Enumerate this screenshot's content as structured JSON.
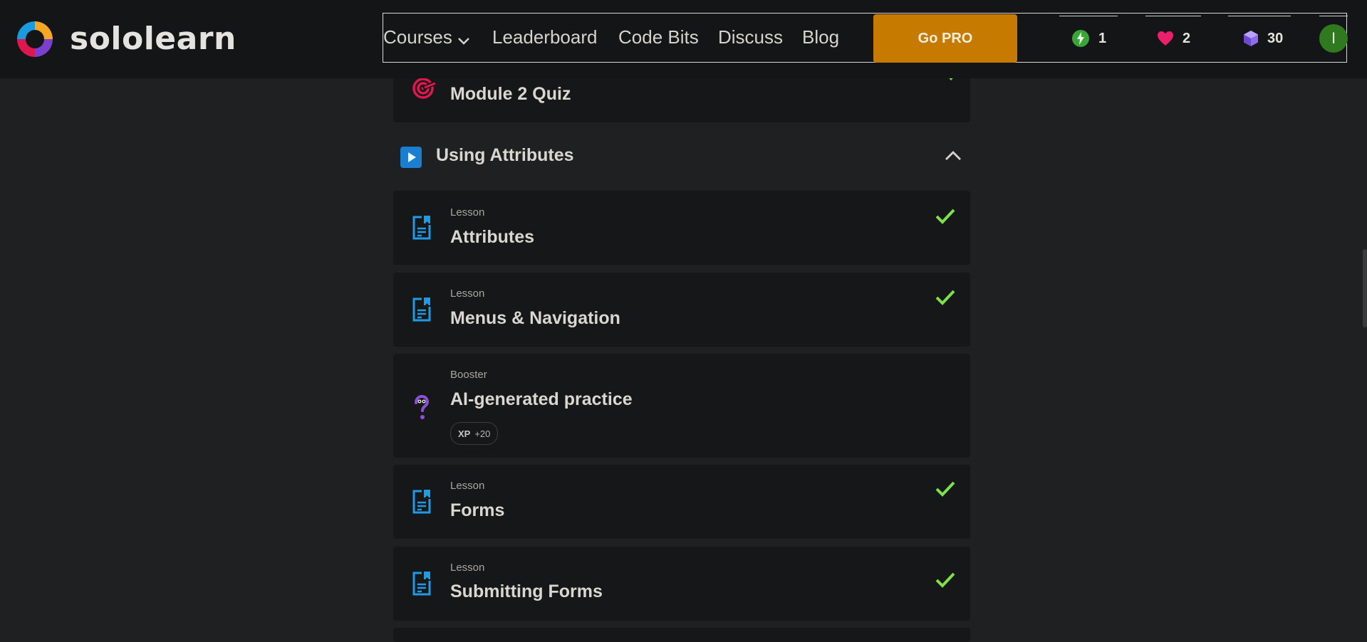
{
  "brand": {
    "name": "sololearn"
  },
  "nav": {
    "courses": "Courses",
    "leaderboard": "Leaderboard",
    "code_bits": "Code Bits",
    "discuss": "Discuss",
    "blog": "Blog",
    "go_pro": "Go PRO"
  },
  "stats": {
    "streak": "1",
    "hearts": "2",
    "gems": "30",
    "avatar_initial": "I"
  },
  "content": {
    "quiz": {
      "title": "Module 2 Quiz",
      "icon": "target-icon"
    },
    "section": {
      "title": "Using Attributes",
      "icon": "play-icon",
      "expanded": true
    },
    "items": [
      {
        "kind": "Lesson",
        "title": "Attributes",
        "completed": true
      },
      {
        "kind": "Lesson",
        "title": "Menus & Navigation",
        "completed": true
      },
      {
        "kind": "Booster",
        "title": "AI-generated practice",
        "xp_label": "XP",
        "xp_value": "+20",
        "completed": false
      },
      {
        "kind": "Lesson",
        "title": "Forms",
        "completed": true
      },
      {
        "kind": "Lesson",
        "title": "Submitting Forms",
        "completed": true
      }
    ]
  },
  "colors": {
    "background": "#1f2021",
    "topbar": "#141517",
    "card": "#161718",
    "go_pro": "#c67a00",
    "check": "#7ee04a",
    "lesson_icon": "#1f9be6",
    "quiz_icon": "#e0174f",
    "booster_icon": "#8b4fd8",
    "avatar": "#2f7a1f"
  }
}
